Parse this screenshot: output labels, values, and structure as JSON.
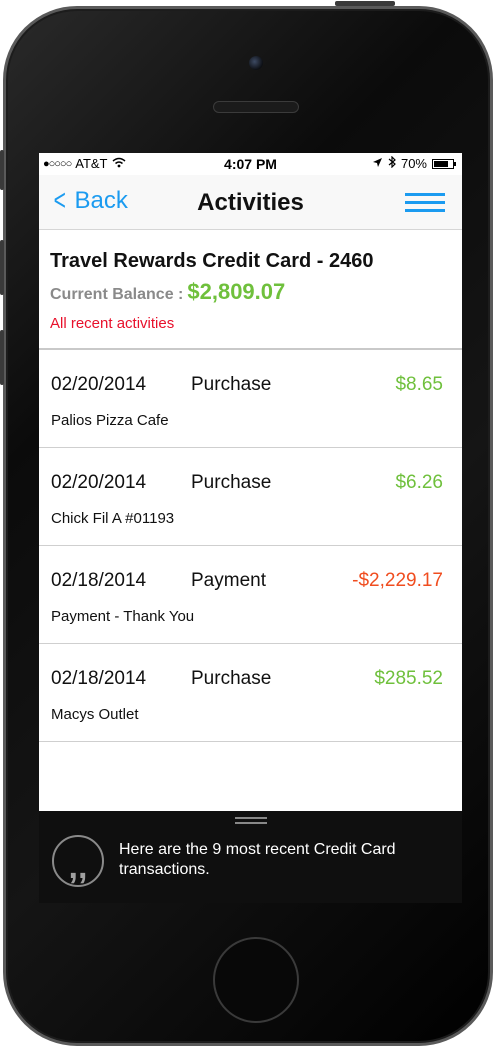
{
  "status_bar": {
    "carrier": "AT&T",
    "time": "4:07 PM",
    "battery": "70%"
  },
  "nav": {
    "back_label": "Back",
    "title": "Activities"
  },
  "account": {
    "name": "Travel Rewards Credit Card - 2460",
    "balance_label": "Current Balance :",
    "balance_value": "$2,809.07",
    "filter_label": "All recent activities"
  },
  "transactions": [
    {
      "date": "02/20/2014",
      "type": "Purchase",
      "amount": "$8.65",
      "merchant": "Palios Pizza Cafe"
    },
    {
      "date": "02/20/2014",
      "type": "Purchase",
      "amount": "$6.26",
      "merchant": "Chick Fil A #01193"
    },
    {
      "date": "02/18/2014",
      "type": "Payment",
      "amount": "-$2,229.17",
      "merchant": "Payment - Thank You"
    },
    {
      "date": "02/18/2014",
      "type": "Purchase",
      "amount": "$285.52",
      "merchant": "Macys Outlet"
    }
  ],
  "assistant": {
    "message": "Here are the 9 most recent Credit Card transactions."
  },
  "colors": {
    "accent": "#1b9bf0",
    "positive": "#6fc03c",
    "negative": "#f04d1f",
    "alert": "#e8102b"
  },
  "icons": {
    "back": "chevron-left-icon",
    "menu": "list-menu-icon",
    "assistant": "quote-icon"
  }
}
